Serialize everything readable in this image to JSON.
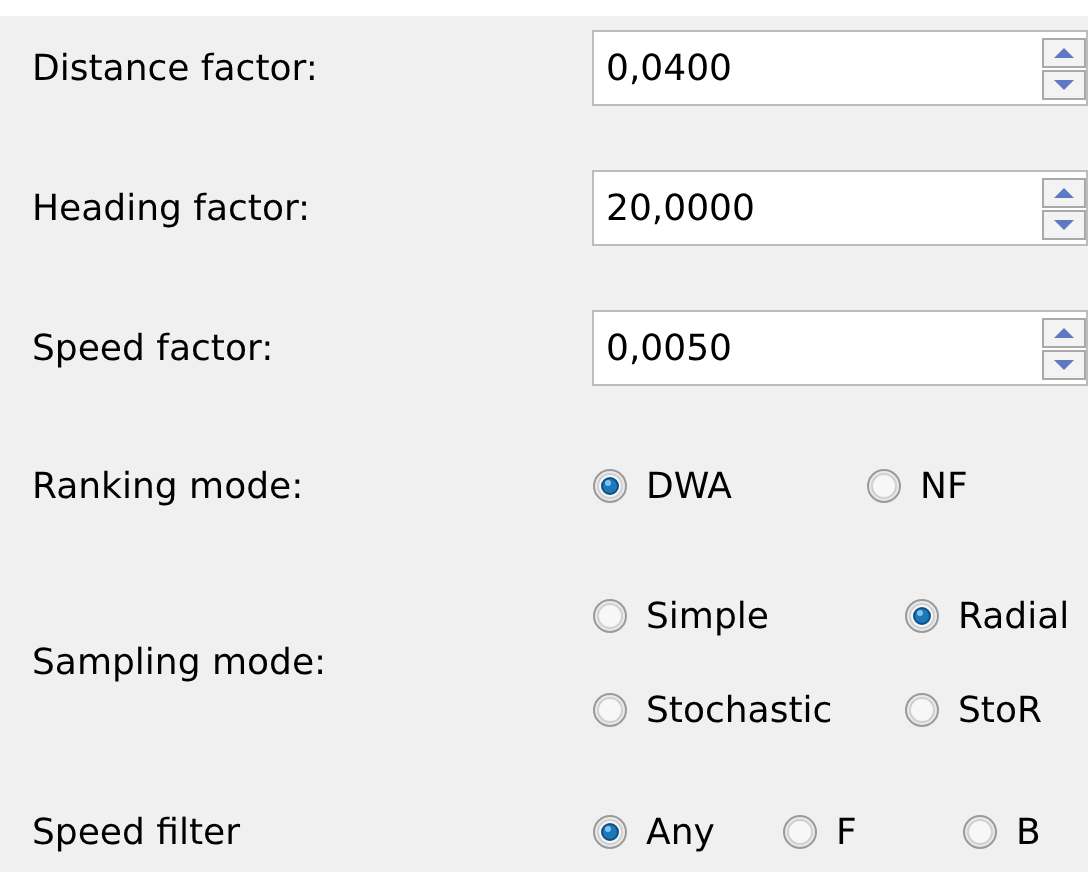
{
  "fields": [
    {
      "label": "Distance factor:",
      "value": "0,0400"
    },
    {
      "label": "Heading factor:",
      "value": "20,0000"
    },
    {
      "label": "Speed factor:",
      "value": "0,0050"
    }
  ],
  "radio_groups": [
    {
      "label": "Ranking mode:",
      "options": [
        {
          "label": "DWA",
          "selected": true
        },
        {
          "label": "NF",
          "selected": false
        }
      ]
    },
    {
      "label": "Sampling mode:",
      "options": [
        {
          "label": "Simple",
          "selected": false
        },
        {
          "label": "Radial",
          "selected": true
        },
        {
          "label": "Stochastic",
          "selected": false
        },
        {
          "label": "StoR",
          "selected": false
        }
      ]
    },
    {
      "label": "Speed filter",
      "options": [
        {
          "label": "Any",
          "selected": true
        },
        {
          "label": "F",
          "selected": false
        },
        {
          "label": "B",
          "selected": false
        }
      ]
    }
  ]
}
